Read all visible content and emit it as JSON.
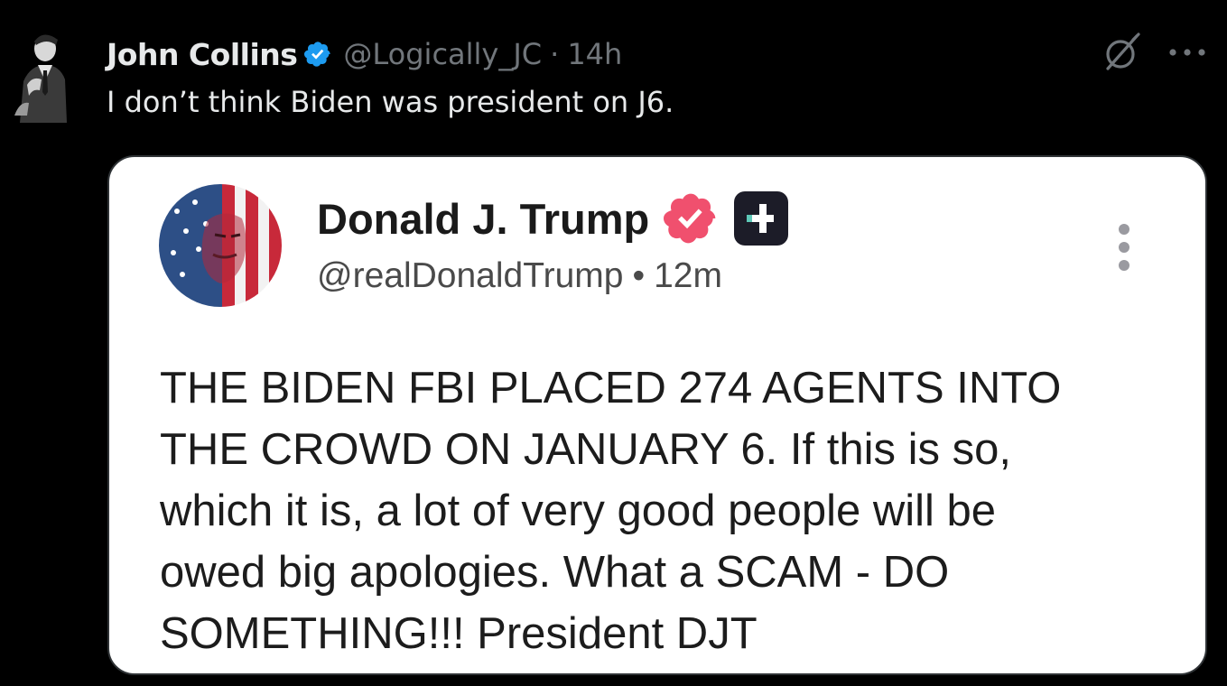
{
  "tweet": {
    "author_name": "John Collins",
    "author_handle": "@Logically_JC",
    "separator": "·",
    "time": "14h",
    "text": "I don’t think Biden was president on J6."
  },
  "icons": {
    "verified": "verified-badge-icon",
    "grok": "grok-slash-icon",
    "more": "more-options-icon"
  },
  "colors": {
    "background": "#000000",
    "text_primary": "#e7e9ea",
    "text_secondary": "#71767b",
    "verified_blue": "#1d9bf0",
    "truth_badge": "#f0506e"
  },
  "embedded_post": {
    "author_name": "Donald J. Trump",
    "author_handle": "@realDonaldTrump",
    "separator": "•",
    "time": "12m",
    "lines": [
      "THE BIDEN FBI PLACED 274 AGENTS INTO",
      "THE CROWD ON JANUARY 6. If this is so,",
      "which it is, a lot of very good people will be",
      "owed big apologies. What a SCAM - DO",
      "SOMETHING!!! President DJT"
    ]
  }
}
